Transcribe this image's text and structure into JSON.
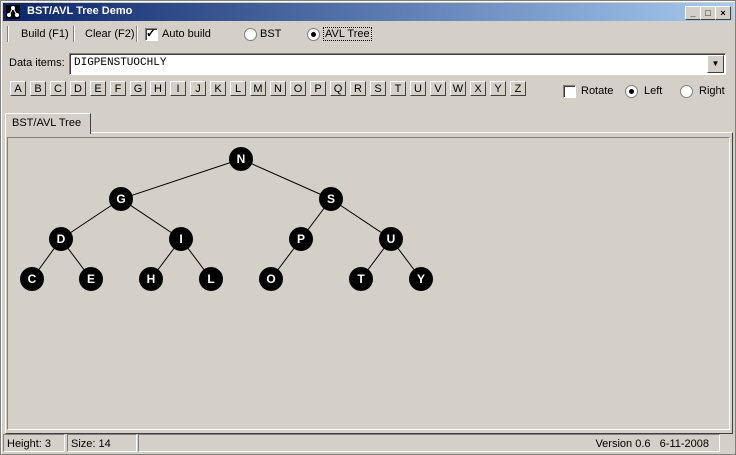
{
  "window": {
    "title": "BST/AVL Tree Demo"
  },
  "toolbar": {
    "build_label": "Build (F1)",
    "clear_label": "Clear (F2)",
    "auto_build_label": "Auto build",
    "auto_build_checked": true,
    "bst_label": "BST",
    "avl_label": "AVL Tree",
    "selected_mode": "AVL Tree"
  },
  "data_items": {
    "label": "Data items:",
    "value": "DIGPENSTUOCHLY"
  },
  "letters": [
    "A",
    "B",
    "C",
    "D",
    "E",
    "F",
    "G",
    "H",
    "I",
    "J",
    "K",
    "L",
    "M",
    "N",
    "O",
    "P",
    "Q",
    "R",
    "S",
    "T",
    "U",
    "V",
    "W",
    "X",
    "Y",
    "Z"
  ],
  "options": {
    "rotate_label": "Rotate",
    "rotate_checked": false,
    "left_label": "Left",
    "right_label": "Right",
    "selected_direction": "Left"
  },
  "tab": {
    "label": "BST/AVL Tree"
  },
  "tree": {
    "nodes": [
      "N",
      "G",
      "S",
      "D",
      "I",
      "P",
      "U",
      "C",
      "E",
      "H",
      "L",
      "O",
      "T",
      "Y"
    ],
    "edges": [
      [
        "N",
        "G"
      ],
      [
        "N",
        "S"
      ],
      [
        "G",
        "D"
      ],
      [
        "G",
        "I"
      ],
      [
        "S",
        "P"
      ],
      [
        "S",
        "U"
      ],
      [
        "D",
        "C"
      ],
      [
        "D",
        "E"
      ],
      [
        "I",
        "H"
      ],
      [
        "I",
        "L"
      ],
      [
        "P",
        "O"
      ],
      [
        "U",
        "T"
      ],
      [
        "U",
        "Y"
      ]
    ]
  },
  "status": {
    "height": "Height: 3",
    "size": "Size: 14",
    "version": "Version 0.6   6-11-2008"
  }
}
